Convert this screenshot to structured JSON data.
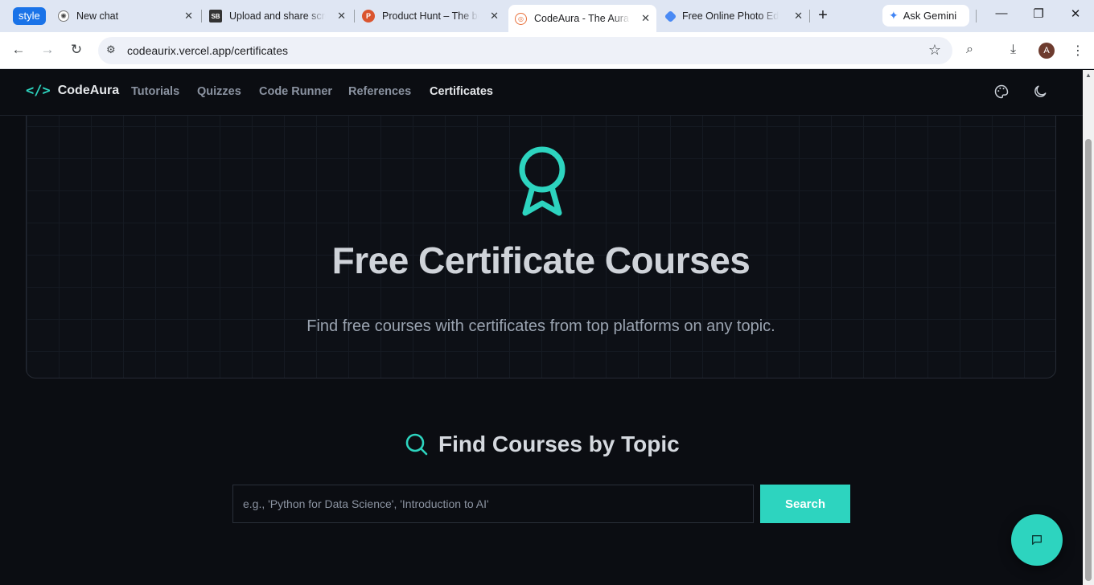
{
  "browser": {
    "tab_group_label": "style",
    "tabs": [
      {
        "title": "New chat",
        "icon": "openai-icon"
      },
      {
        "title": "Upload and share scre",
        "icon": "sb-icon"
      },
      {
        "title": "Product Hunt – The be",
        "icon": "product-hunt-icon"
      },
      {
        "title": "CodeAura - The Aura o",
        "icon": "codeaura-icon",
        "active": true
      },
      {
        "title": "Free Online Photo Edit",
        "icon": "photo-editor-icon"
      }
    ],
    "sb_icon_text": "SB",
    "ph_icon_text": "P",
    "ask_gemini": "Ask Gemini",
    "url": "codeaurix.vercel.app/certificates",
    "avatar_initial": "A"
  },
  "site": {
    "brand": "CodeAura",
    "logo_glyph": "</>",
    "nav": [
      "Tutorials",
      "Quizzes",
      "Code Runner",
      "References",
      "Certificates"
    ],
    "active_nav": "Certificates",
    "accent_color": "#2dd4bf"
  },
  "hero": {
    "title": "Free Certificate Courses",
    "subtitle": "Find free courses with certificates from top platforms on any topic."
  },
  "search": {
    "heading": "Find Courses by Topic",
    "placeholder": "e.g., 'Python for Data Science', 'Introduction to AI'",
    "value": "",
    "button_label": "Search"
  }
}
